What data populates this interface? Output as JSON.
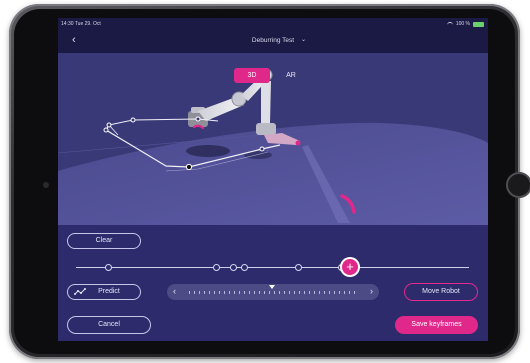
{
  "status_bar": {
    "time": "14:30  Tue 29. Oct",
    "battery": "100 %"
  },
  "header": {
    "title": "Deburring Test",
    "title_chevron": "⌄",
    "back_icon": "‹"
  },
  "viewport": {
    "view_modes": [
      "3D",
      "AR"
    ],
    "selected_view": "3D"
  },
  "controls": {
    "clear_label": "Clear",
    "predict_label": "Predict",
    "move_robot_label": "Move Robot",
    "cancel_label": "Cancel",
    "save_label": "Save keyframes",
    "add_keyframe_label": "+",
    "scrub_left": "‹",
    "scrub_right": "›"
  },
  "colors": {
    "accent": "#e0288a",
    "panel": "#2d2b6b",
    "viewport": "#3a3977",
    "header": "#1b1a44"
  }
}
